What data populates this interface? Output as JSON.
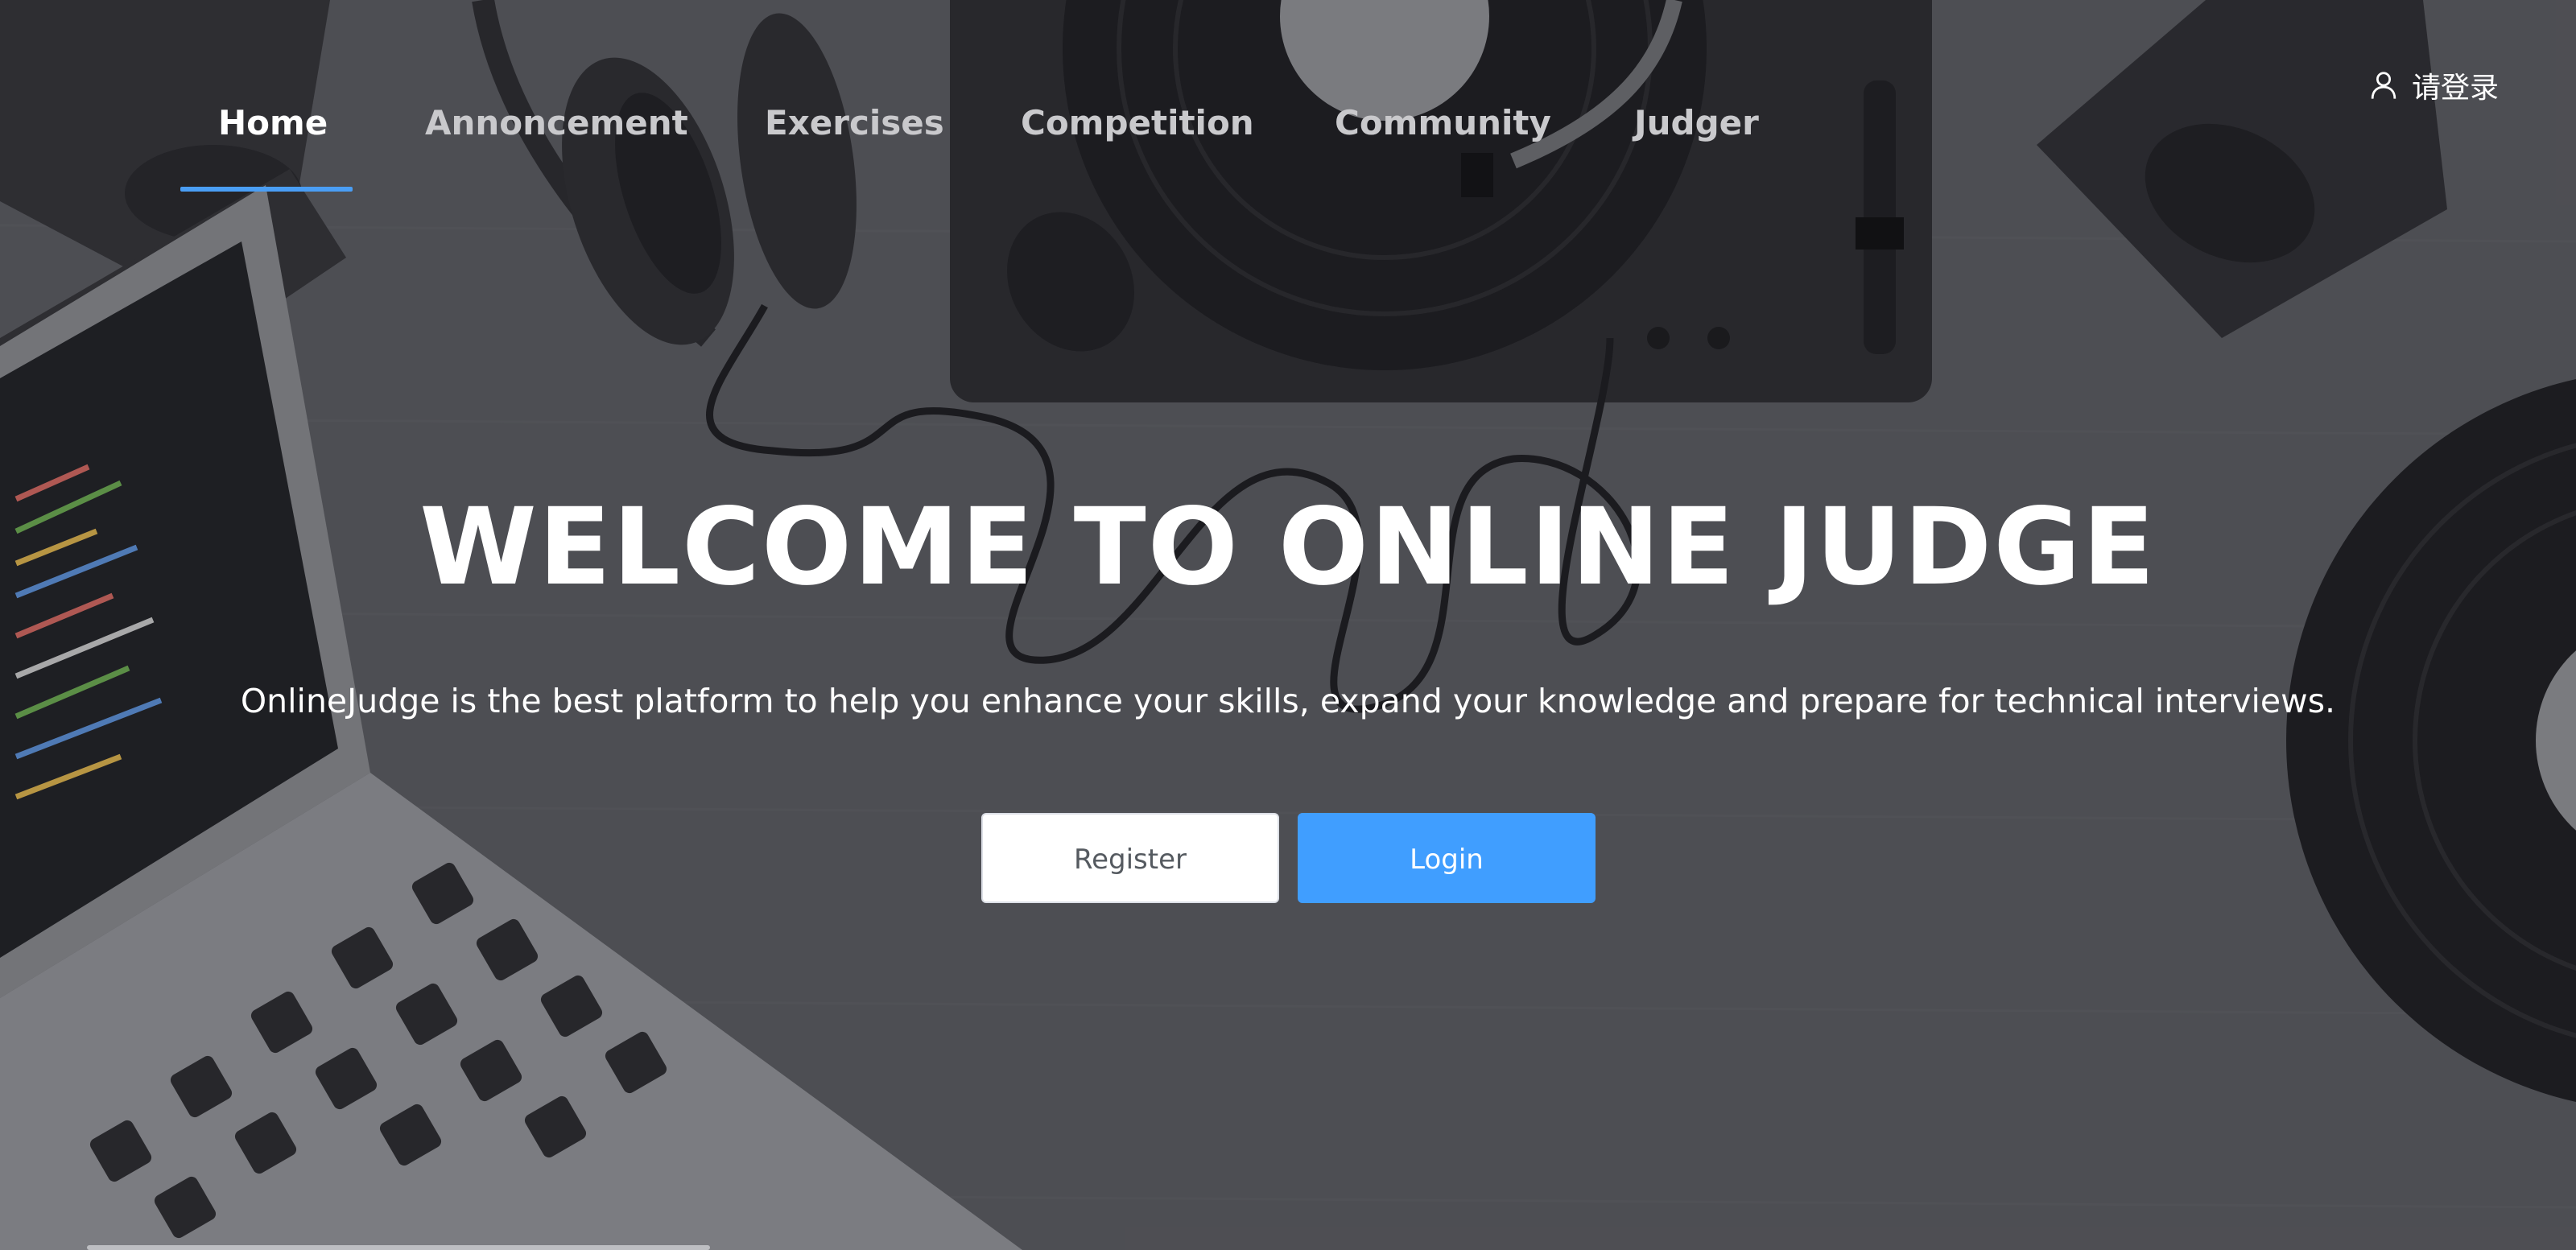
{
  "nav": {
    "items": [
      {
        "label": "Home",
        "active": true
      },
      {
        "label": "Annoncement",
        "active": false
      },
      {
        "label": "Exercises",
        "active": false
      },
      {
        "label": "Competition",
        "active": false
      },
      {
        "label": "Community",
        "active": false
      },
      {
        "label": "Judger",
        "active": false
      }
    ],
    "accent_color": "#4a9ef5"
  },
  "user": {
    "login_label": "请登录",
    "icon": "user-icon"
  },
  "hero": {
    "title": "WELCOME TO ONLINE JUDGE",
    "subtitle": "OnlineJudge is the best platform to help you enhance your skills, expand your knowledge and prepare for technical interviews.",
    "register_label": "Register",
    "login_label": "Login"
  },
  "colors": {
    "primary": "#409eff",
    "background": "#55565b",
    "text": "#ffffff"
  }
}
